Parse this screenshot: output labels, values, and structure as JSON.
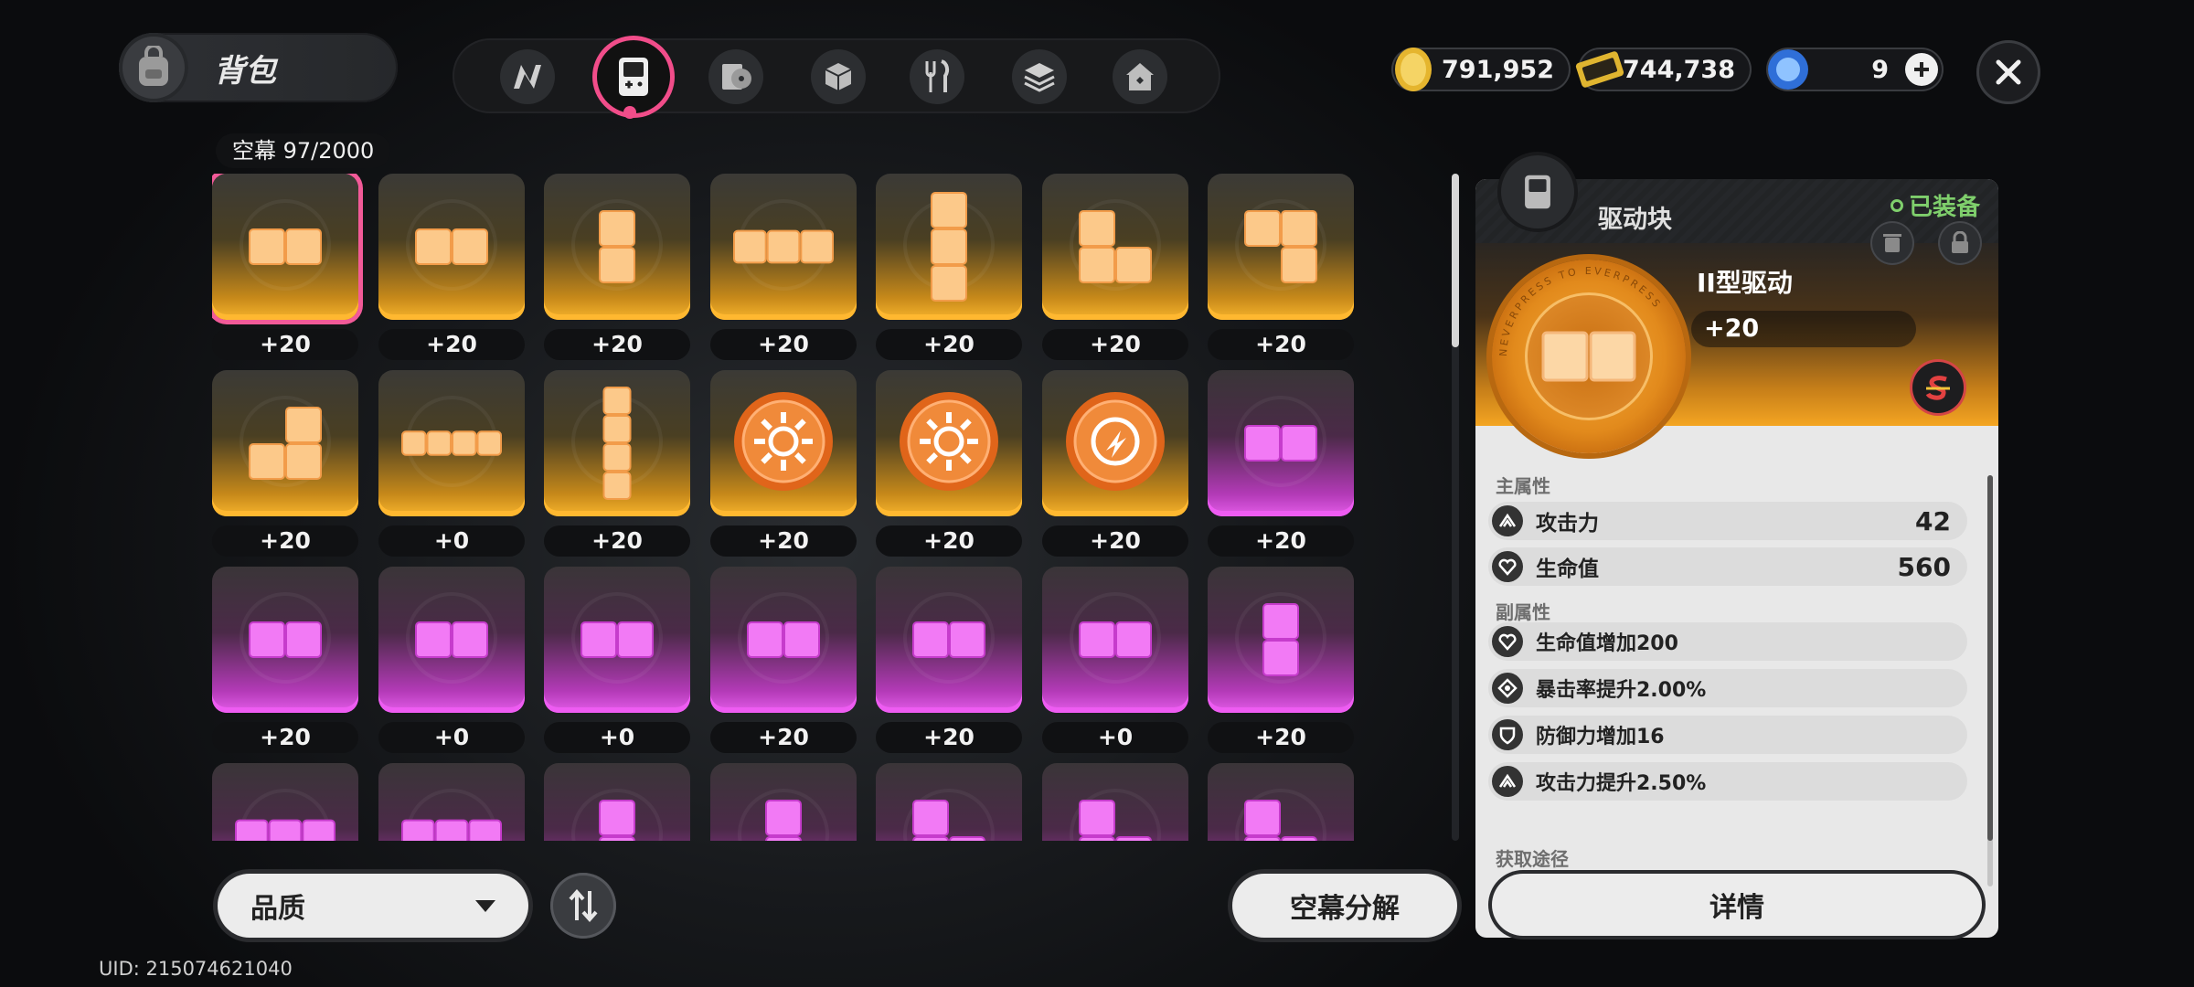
{
  "header": {
    "title": "背包"
  },
  "tabs": [
    {
      "icon": "n-logo-icon"
    },
    {
      "icon": "handheld-device-icon",
      "active": true
    },
    {
      "icon": "disc-record-icon"
    },
    {
      "icon": "cube-box-icon"
    },
    {
      "icon": "fork-knife-icon"
    },
    {
      "icon": "layered-box-icon"
    },
    {
      "icon": "home-icon"
    }
  ],
  "currency": [
    {
      "icon": "gold-coin-icon",
      "value": "791,952"
    },
    {
      "icon": "ticket-icon",
      "value": "744,738"
    },
    {
      "icon": "blue-orb-icon",
      "value": "9"
    }
  ],
  "inventory": {
    "capacity": "空幕  97/2000",
    "rows": [
      [
        {
          "rarity": "gold",
          "shape": "h2",
          "level": "+20",
          "selected": true
        },
        {
          "rarity": "gold",
          "shape": "h2",
          "level": "+20"
        },
        {
          "rarity": "gold",
          "shape": "v2",
          "level": "+20"
        },
        {
          "rarity": "gold",
          "shape": "h3",
          "level": "+20"
        },
        {
          "rarity": "gold",
          "shape": "v3",
          "level": "+20"
        },
        {
          "rarity": "gold",
          "shape": "L",
          "level": "+20"
        },
        {
          "rarity": "gold",
          "shape": "J",
          "level": "+20"
        }
      ],
      [
        {
          "rarity": "gold",
          "shape": "Jr",
          "level": "+20"
        },
        {
          "rarity": "gold",
          "shape": "h4",
          "level": "+0"
        },
        {
          "rarity": "gold",
          "shape": "v4",
          "level": "+20"
        },
        {
          "rarity": "gold",
          "shape": "coin-sun",
          "level": "+20"
        },
        {
          "rarity": "gold",
          "shape": "coin-sun",
          "level": "+20"
        },
        {
          "rarity": "gold",
          "shape": "coin-bolt",
          "level": "+20"
        },
        {
          "rarity": "pink",
          "shape": "h2",
          "level": "+20"
        }
      ],
      [
        {
          "rarity": "pink",
          "shape": "h2",
          "level": "+20"
        },
        {
          "rarity": "pink",
          "shape": "h2",
          "level": "+0"
        },
        {
          "rarity": "pink",
          "shape": "h2",
          "level": "+0"
        },
        {
          "rarity": "pink",
          "shape": "h2",
          "level": "+20"
        },
        {
          "rarity": "pink",
          "shape": "h2",
          "level": "+20"
        },
        {
          "rarity": "pink",
          "shape": "h2",
          "level": "+0"
        },
        {
          "rarity": "pink",
          "shape": "v2",
          "level": "+20"
        }
      ],
      [
        {
          "rarity": "pink",
          "shape": "h3",
          "level": ""
        },
        {
          "rarity": "pink",
          "shape": "h3",
          "level": ""
        },
        {
          "rarity": "pink",
          "shape": "v2",
          "level": ""
        },
        {
          "rarity": "pink",
          "shape": "v2",
          "level": ""
        },
        {
          "rarity": "pink",
          "shape": "L",
          "level": ""
        },
        {
          "rarity": "pink",
          "shape": "L",
          "level": ""
        },
        {
          "rarity": "pink",
          "shape": "L",
          "level": ""
        }
      ]
    ]
  },
  "controls": {
    "quality_label": "品质",
    "decompose_label": "空幕分解"
  },
  "uid": "UID: 215074621040",
  "detail": {
    "category": "驱动块",
    "equipped": "已装备",
    "name": "II型驱动",
    "level": "+20",
    "main_label": "主属性",
    "main_stats": [
      {
        "icon": "attack-icon",
        "name": "攻击力",
        "value": "42"
      },
      {
        "icon": "heart-icon",
        "name": "生命值",
        "value": "560"
      }
    ],
    "sub_label": "副属性",
    "sub_stats": [
      {
        "icon": "heart-icon",
        "name": "生命值增加200"
      },
      {
        "icon": "crit-icon",
        "name": "暴击率提升2.00%"
      },
      {
        "icon": "shield-icon",
        "name": "防御力增加16"
      },
      {
        "icon": "attack-icon",
        "name": "攻击力提升2.50%"
      }
    ],
    "source_label": "获取途径",
    "details_button": "详情",
    "disc_text": "NEVERPRESS TO EVERPRESS"
  },
  "colors": {
    "gold": "#f7b42c",
    "pink": "#e45ce9",
    "accent": "#f14d8a",
    "equipped": "#7fcf6c"
  }
}
